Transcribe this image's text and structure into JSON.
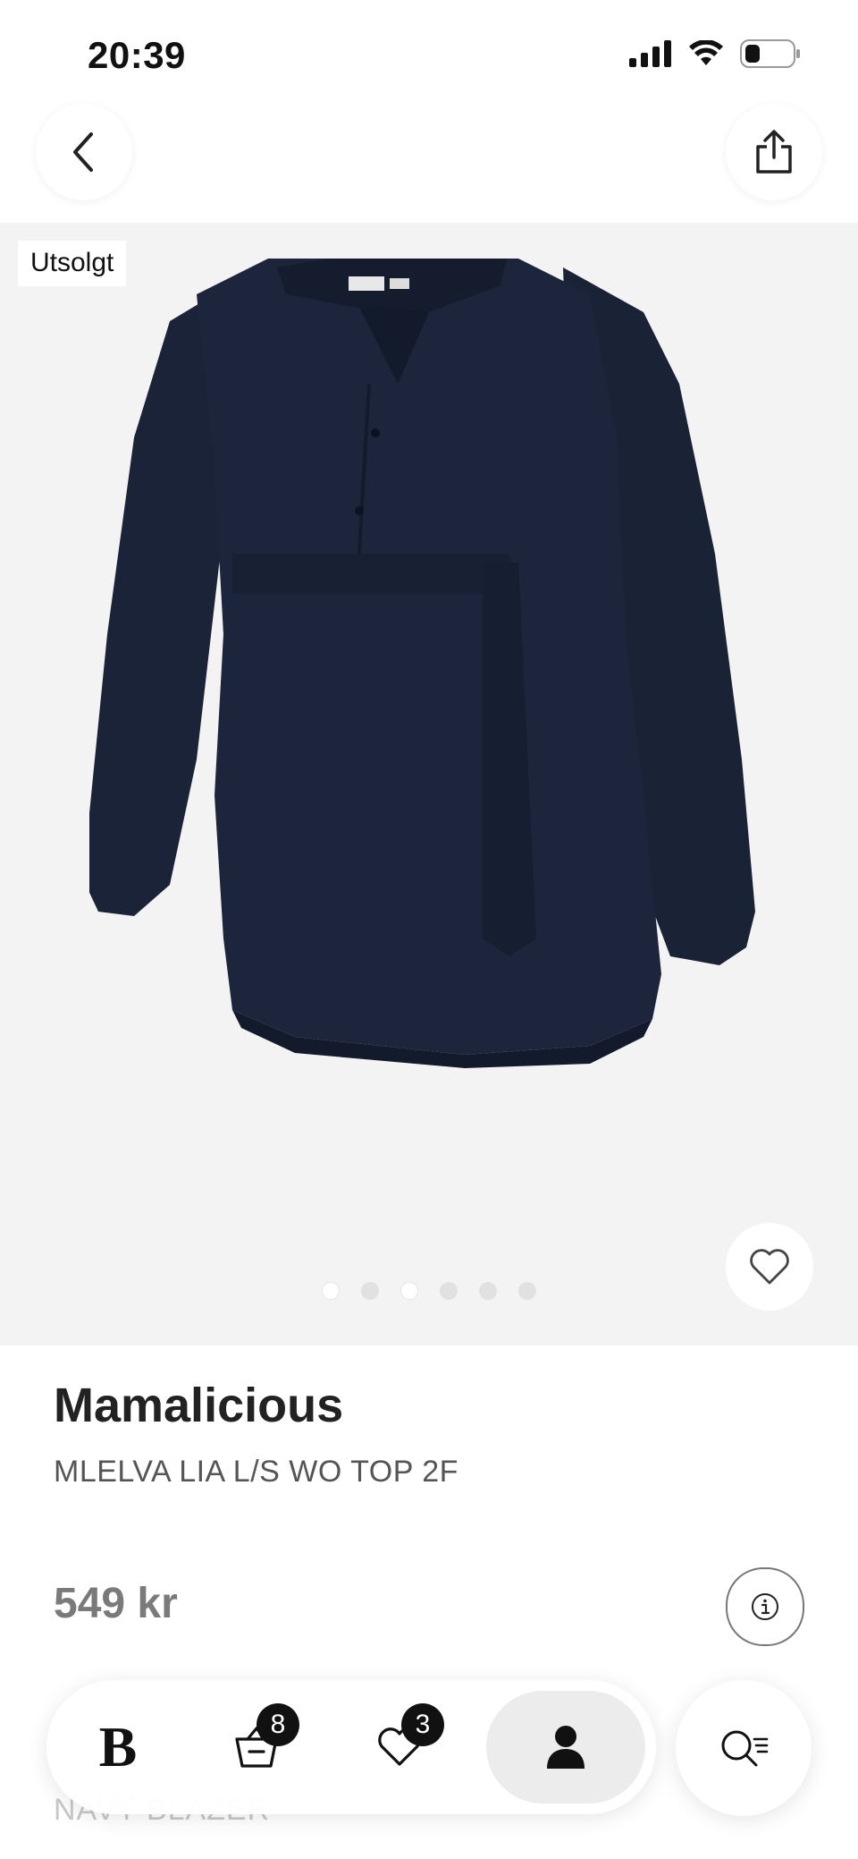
{
  "status_bar": {
    "time": "20:39"
  },
  "hero": {
    "badge": "Utsolgt",
    "image_count": 6,
    "active_image": 1
  },
  "product": {
    "brand": "Mamalicious",
    "name": "MLELVA LIA L/S WO TOP 2F",
    "price": "549 kr",
    "color_label": "NAVY BLAZER"
  },
  "nav": {
    "home_logo": "B",
    "cart_count": "8",
    "wishlist_count": "3"
  },
  "icons": {
    "back": "chevron-left-icon",
    "share": "share-icon",
    "favorite": "heart-outline-icon",
    "info": "info-icon",
    "cart": "shopping-bag-icon",
    "wishlist": "heart-outline-icon",
    "profile": "person-icon",
    "search": "search-filter-icon"
  },
  "colors": {
    "garment": "#1a2237",
    "hero_bg": "#f3f3f3",
    "price": "#7a7a7a",
    "badge_bg": "#111111"
  }
}
